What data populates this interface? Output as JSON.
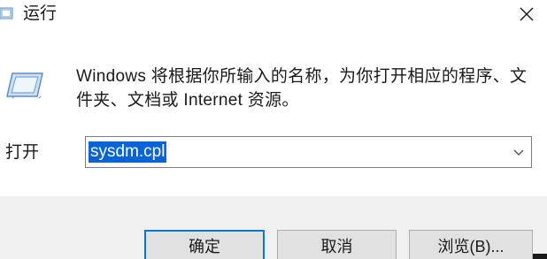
{
  "window": {
    "title": "运行",
    "icon": "run-icon"
  },
  "body": {
    "description": "Windows 将根据你所输入的名称，为你打开相应的程序、文件夹、文档或 Internet 资源。",
    "icon": "run-icon"
  },
  "open_field": {
    "label": "打开",
    "value": "sysdm.cpl",
    "dropdown_icon": "chevron-down-icon"
  },
  "buttons": {
    "ok": "确定",
    "cancel": "取消",
    "browse": "浏览(B)..."
  },
  "colors": {
    "selection": "#0a64d4",
    "focus_border": "#0078d7",
    "footer_bg": "#f0f0f0"
  }
}
